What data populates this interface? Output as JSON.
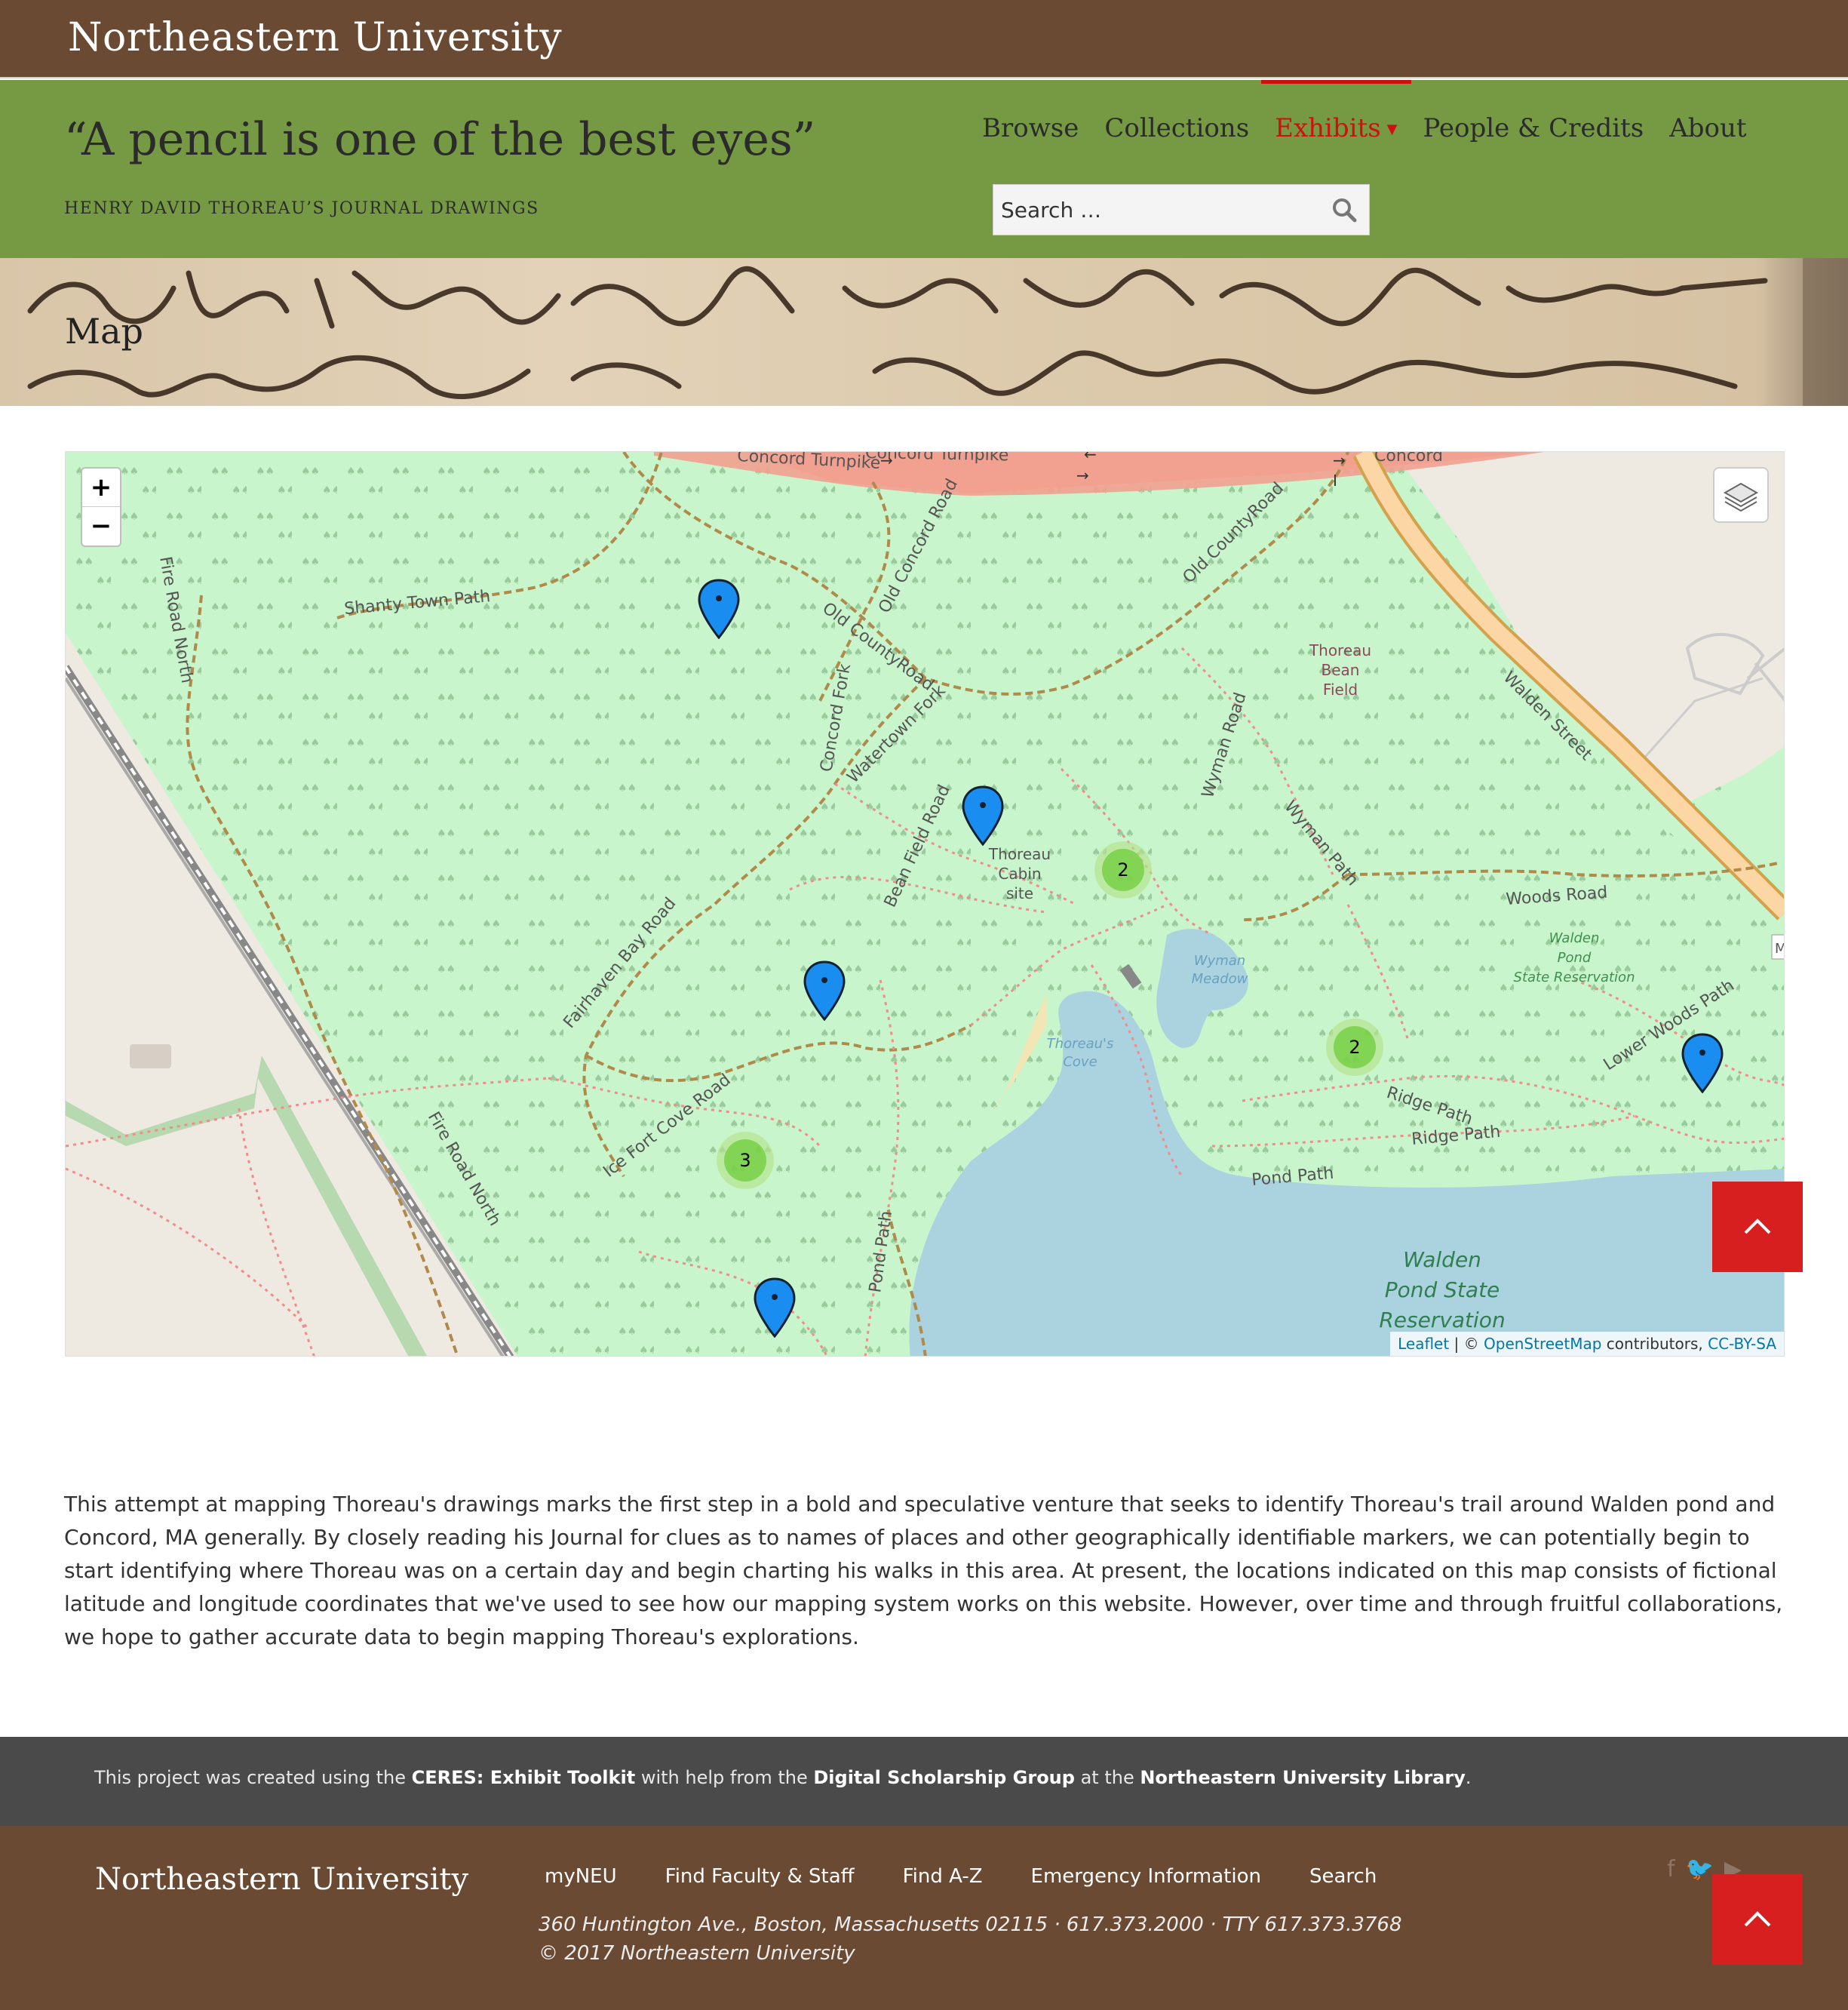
{
  "topbar": {
    "university": "Northeastern University"
  },
  "header": {
    "title": "“A pencil is one of the best eyes”",
    "subtitle": "HENRY DAVID THOREAU’S JOURNAL DRAWINGS",
    "nav": [
      {
        "label": "Browse"
      },
      {
        "label": "Collections"
      },
      {
        "label": "Exhibits",
        "active": true
      },
      {
        "label": "People & Credits"
      },
      {
        "label": "About"
      }
    ],
    "search_placeholder": "Search …"
  },
  "banner": {
    "title": "Map"
  },
  "map": {
    "zoom_in": "+",
    "zoom_out": "−",
    "clusters": [
      "2",
      "2",
      "3"
    ],
    "attribution": {
      "leaflet": "Leaflet",
      "sep": " | © ",
      "osm": "OpenStreetMap",
      "contrib": " contributors, ",
      "license": "CC-BY-SA"
    },
    "labels": {
      "shanty": "Shanty Town Path",
      "fire_road_north_1": "Fire Road North",
      "fire_road_north_2": "Fire Road North",
      "old_concord": "Old Concord Road",
      "old_county_1": "Old CountyRoad",
      "old_county_2": "Old CountyRoad",
      "concord_fork": "Concord Fork",
      "watertown_fork": "Watertown Fork",
      "wyman_road": "Wyman Road",
      "wyman_path": "Wyman Path",
      "bean_field_road": "Bean Field Road",
      "fairhaven": "Fairhaven Bay Road",
      "ice_fort": "Ice Fort Cove Road",
      "pond_path_1": "Pond Path",
      "pond_path_2": "Pond Path",
      "ridge_path_1": "Ridge Path",
      "ridge_path_2": "Ridge Path",
      "woods_road": "Woods Road",
      "lower_woods": "Lower Woods Path",
      "walden_street": "Walden Street",
      "turnpike_1": "Concord Turnpike",
      "turnpike_2": "Concord Turnpike",
      "concord": "Concord",
      "bean_field_1": "Thoreau",
      "bean_field_2": "Bean",
      "bean_field_3": "Field",
      "cabin_1": "Thoreau",
      "cabin_2": "Cabin",
      "cabin_3": "site",
      "wyman_meadow_1": "Wyman",
      "wyman_meadow_2": "Meadow",
      "cove_1": "Thoreau's",
      "cove_2": "Cove",
      "reservation_small_1": "Walden",
      "reservation_small_2": "Pond",
      "reservation_small_3": "State Reservation",
      "reservation_big_1": "Walden",
      "reservation_big_2": "Pond State",
      "reservation_big_3": "Reservation",
      "edge_m": "M"
    }
  },
  "intro": "This attempt at mapping Thoreau's drawings marks the first step in a bold and speculative venture that seeks to identify Thoreau's trail around Walden pond and Concord, MA generally. By closely reading his Journal for clues as to names of places and other geographically identifiable markers, we can potentially begin to start identifying where Thoreau was on a certain day and begin charting his walks in this area. At present, the locations indicated on this map consists of fictional latitude and longitude coordinates that we've used to see how our mapping system works on this website. However, over time and through fruitful collaborations, we hope to gather accurate data to begin mapping Thoreau's explorations.",
  "credit": {
    "pre": "This project was created using the ",
    "toolkit": "CERES: Exhibit Toolkit",
    "mid1": " with help from the ",
    "group": "Digital Scholarship Group",
    "mid2": " at the ",
    "library": "Northeastern University Library",
    "end": "."
  },
  "footer": {
    "university": "Northeastern University",
    "links": [
      "myNEU",
      "Find Faculty & Staff",
      "Find A-Z",
      "Emergency Information",
      "Search"
    ],
    "address": "360 Huntington Ave., Boston, Massachusetts 02115 · 617.373.2000 · TTY 617.373.3768",
    "copyright": "© 2017 Northeastern University",
    "social": [
      "facebook-icon",
      "twitter-icon",
      "youtube-icon"
    ]
  },
  "colors": {
    "header_green": "#769a43",
    "brown": "#6b4a33",
    "accent_red": "#d01010",
    "map_green": "#c8f5cb",
    "water": "#aad3df"
  }
}
